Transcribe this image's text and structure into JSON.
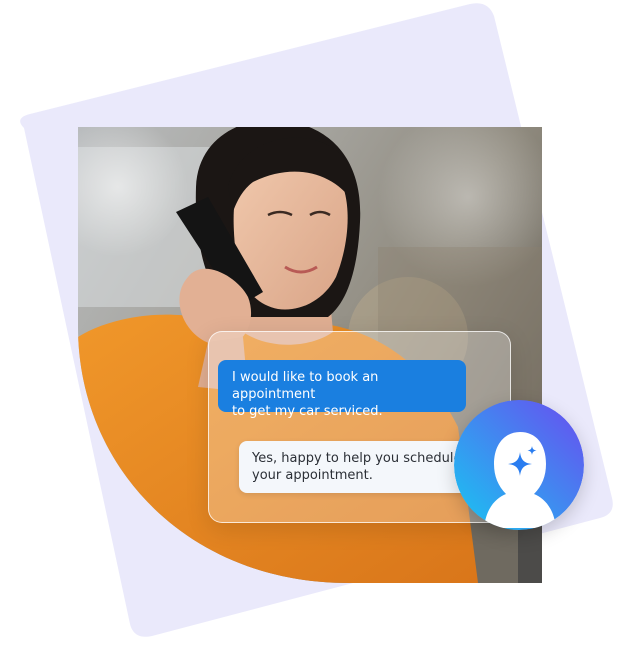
{
  "colors": {
    "lavender_backdrop": "#eae9fb",
    "user_bubble": "#1a7fe0",
    "bot_bubble": "#f4f7fb",
    "avatar_gradient_start": "#17c7f1",
    "avatar_gradient_end": "#6a4cf0"
  },
  "photo": {
    "subject": "woman-on-phone",
    "shirt_color": "#e98a1f"
  },
  "chat": {
    "user_message": {
      "line1": "I would like to book an appointment",
      "line2": "to get my car serviced."
    },
    "bot_message": {
      "line1": "Yes, happy to help you schedule",
      "line2": "your appointment."
    }
  },
  "avatar": {
    "icon": "ai-assistant-sparkle-icon"
  }
}
